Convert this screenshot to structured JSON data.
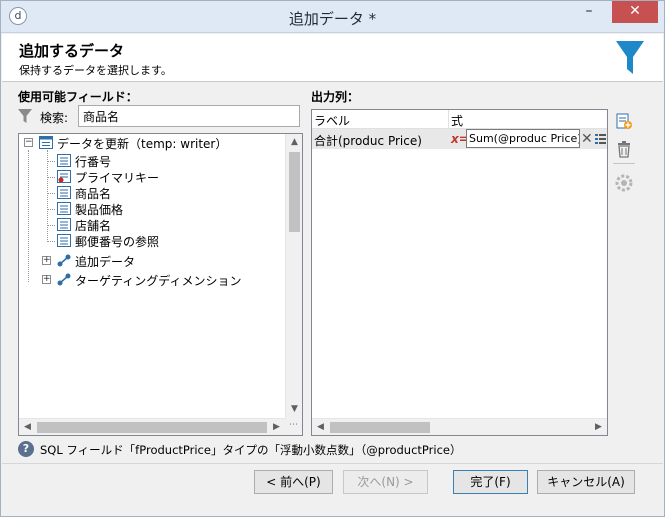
{
  "window": {
    "title": "追加データ *",
    "app_icon": "app-logo-icon"
  },
  "header": {
    "title": "追加するデータ",
    "subtitle": "保持するデータを選択します。",
    "icon": "funnel-icon",
    "accent_color": "#1e88c8"
  },
  "left": {
    "label": "使用可能フィールド：",
    "search_label": "検索:",
    "search_value": "商品名",
    "tree": {
      "root": "データを更新（temp: writer）",
      "fields": [
        "行番号",
        "プライマリキー",
        "商品名",
        "製品価格",
        "店舗名",
        "郵便番号の参照"
      ],
      "nodes": [
        "追加データ",
        "ターゲティングディメンション"
      ]
    }
  },
  "right": {
    "label": "出力列：",
    "columns": {
      "label": "ラベル",
      "expression": "式"
    },
    "row": {
      "label": "合計(produc Price)",
      "fx": "x=",
      "expression": "Sum(@produc Price)"
    }
  },
  "info": {
    "text": "SQL フィールド「fProductPrice」タイプの「浮動小数点数」（@productPrice）"
  },
  "buttons": {
    "prev": "< 前へ(P)",
    "next": "次へ(N) >",
    "finish": "完了(F)",
    "cancel": "キャンセル(A)"
  },
  "controls": {
    "minimize": "–",
    "close": "✕"
  }
}
